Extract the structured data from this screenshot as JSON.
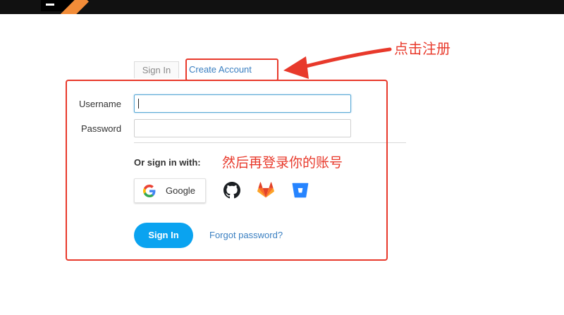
{
  "tabs": {
    "sign_in": "Sign In",
    "create_account": "Create Account"
  },
  "form": {
    "username_label": "Username",
    "password_label": "Password",
    "username_value": "",
    "password_value": "",
    "or_sign_in_with": "Or sign in with:",
    "google_label": "Google",
    "sign_in_button": "Sign In",
    "forgot_password": "Forgot password?"
  },
  "annotations": {
    "click_register": "点击注册",
    "then_login": "然后再登录你的账号"
  },
  "colors": {
    "accent_blue": "#0aa3f0",
    "link_blue": "#3a7fc1",
    "annotation_red": "#e8392b",
    "topbar_orange": "#f28c38"
  },
  "icons": {
    "google": "google-icon",
    "github": "github-icon",
    "gitlab": "gitlab-icon",
    "bitbucket": "bitbucket-icon"
  }
}
